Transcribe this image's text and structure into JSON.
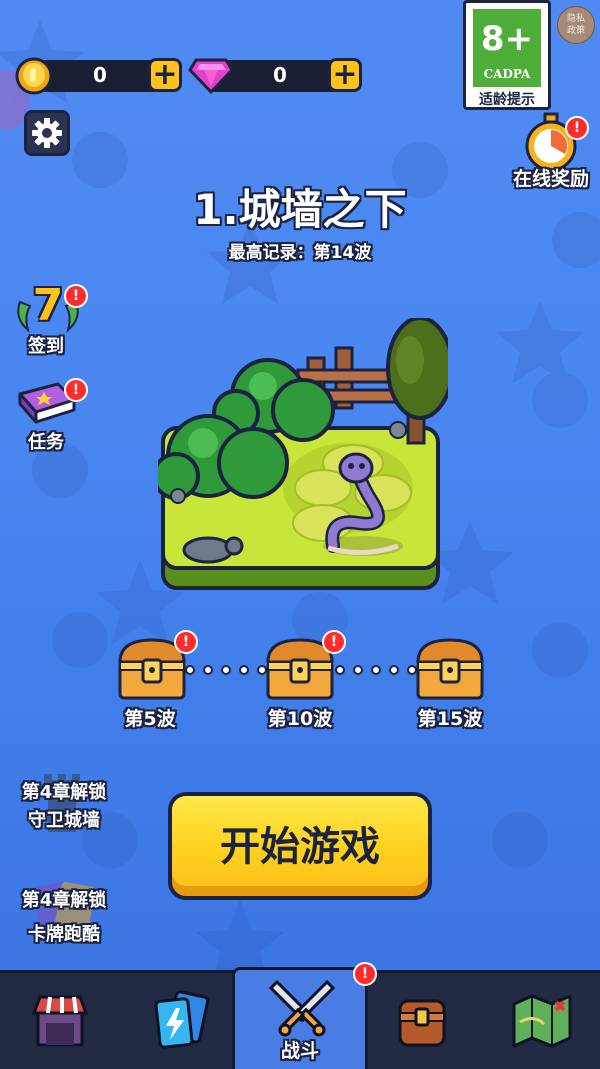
{
  "currency": {
    "coins": {
      "value": "0",
      "icon": "gold-coin-icon"
    },
    "gems": {
      "value": "0",
      "icon": "pink-gem-icon"
    }
  },
  "age_rating": {
    "value": "8+",
    "org": "CADPA",
    "note": "适龄提示"
  },
  "privacy": {
    "line1": "隐私",
    "line2": "政策"
  },
  "online_reward": {
    "label": "在线奖励",
    "badge": "!"
  },
  "level": {
    "title": "1.城墙之下",
    "record": "最高记录：第14波"
  },
  "side_menu": [
    {
      "label": "签到",
      "number": "7",
      "badge": "!"
    },
    {
      "label": "任务",
      "badge": "!"
    }
  ],
  "chests": [
    {
      "label": "第5波",
      "badge": "!"
    },
    {
      "label": "第10波",
      "badge": "!"
    },
    {
      "label": "第15波",
      "badge": ""
    }
  ],
  "locked_modes": [
    {
      "line1": "第4章解锁",
      "line2": "守卫城墙"
    },
    {
      "line1": "第4章解锁",
      "line2": "卡牌跑酷"
    }
  ],
  "start_button": {
    "label": "开始游戏"
  },
  "tabs": [
    {
      "name": "shop",
      "label": ""
    },
    {
      "name": "cards",
      "label": ""
    },
    {
      "name": "battle",
      "label": "战斗",
      "badge": "!"
    },
    {
      "name": "chest",
      "label": ""
    },
    {
      "name": "map",
      "label": ""
    }
  ],
  "colors": {
    "background": "#4a86f0",
    "start_button": "#ffc61f",
    "badge": "#ff2c2c",
    "tab_active": "#4a7de4"
  }
}
